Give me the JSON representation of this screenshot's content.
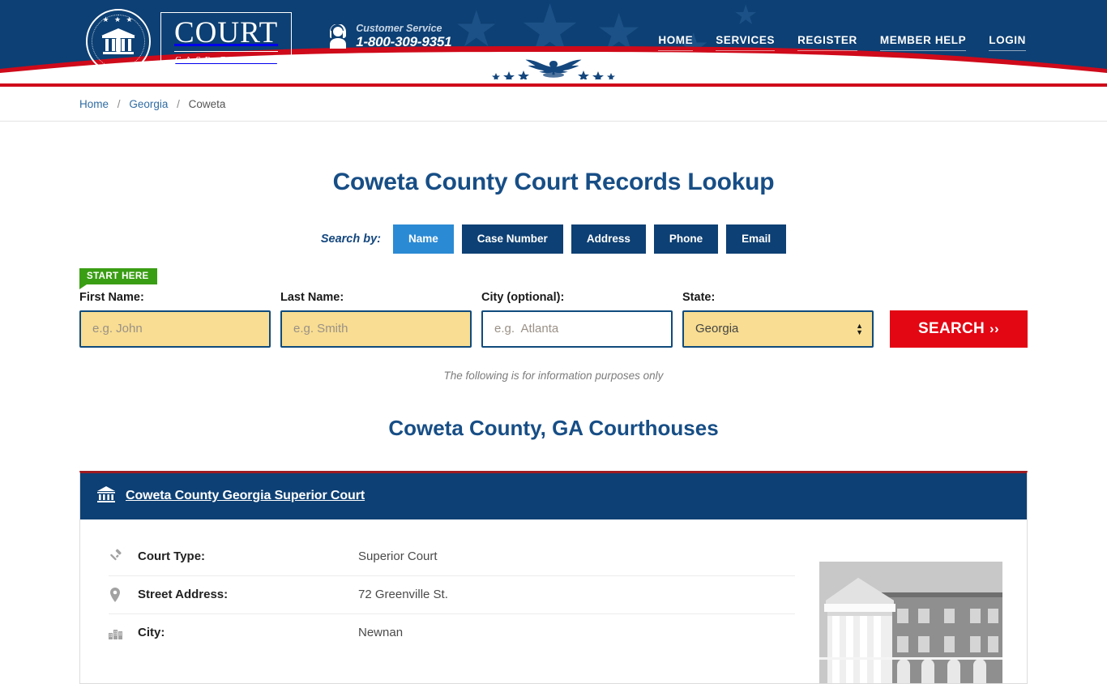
{
  "header": {
    "logo": {
      "word": "COURT",
      "sub": "CASE FINDER",
      "seal_stars": "★ ★ ★"
    },
    "customer_service": {
      "label": "Customer Service",
      "phone": "1-800-309-9351",
      "icon": "headset-support-icon"
    },
    "nav": [
      {
        "label": "HOME"
      },
      {
        "label": "SERVICES"
      },
      {
        "label": "REGISTER"
      },
      {
        "label": "MEMBER HELP"
      },
      {
        "label": "LOGIN"
      }
    ]
  },
  "breadcrumb": {
    "home": "Home",
    "state": "Georgia",
    "current": "Coweta",
    "separator": "/"
  },
  "main": {
    "page_title": "Coweta County Court Records Lookup",
    "search_by_label": "Search by:",
    "tabs": [
      {
        "label": "Name",
        "active": true
      },
      {
        "label": "Case Number",
        "active": false
      },
      {
        "label": "Address",
        "active": false
      },
      {
        "label": "Phone",
        "active": false
      },
      {
        "label": "Email",
        "active": false
      }
    ],
    "start_here_badge": "START HERE",
    "form": {
      "first_name": {
        "label": "First Name:",
        "placeholder": "e.g. John",
        "value": ""
      },
      "last_name": {
        "label": "Last Name:",
        "placeholder": "e.g. Smith",
        "value": ""
      },
      "city": {
        "label": "City (optional):",
        "placeholder": "e.g.  Atlanta",
        "value": ""
      },
      "state": {
        "label": "State:",
        "value": "Georgia"
      },
      "search_button": "SEARCH",
      "search_button_chevron": "››"
    },
    "disclaimer": "The following is for information purposes only",
    "section_title": "Coweta County, GA Courthouses"
  },
  "courthouse": {
    "title": "Coweta County Georgia Superior Court",
    "title_icon": "courthouse-bank-icon",
    "photo_alt": "courthouse-photo",
    "rows": [
      {
        "icon": "gavel-icon",
        "label": "Court Type:",
        "value": "Superior Court"
      },
      {
        "icon": "map-pin-icon",
        "label": "Street Address:",
        "value": "72 Greenville St."
      },
      {
        "icon": "city-buildings-icon",
        "label": "City:",
        "value": "Newnan"
      }
    ]
  },
  "colors": {
    "navy": "#0d4074",
    "red": "#e30613",
    "active_tab_blue": "#2b8ad4",
    "badge_green": "#3a9e14",
    "field_yellow": "#f8dd92",
    "heading_blue": "#174e86"
  }
}
